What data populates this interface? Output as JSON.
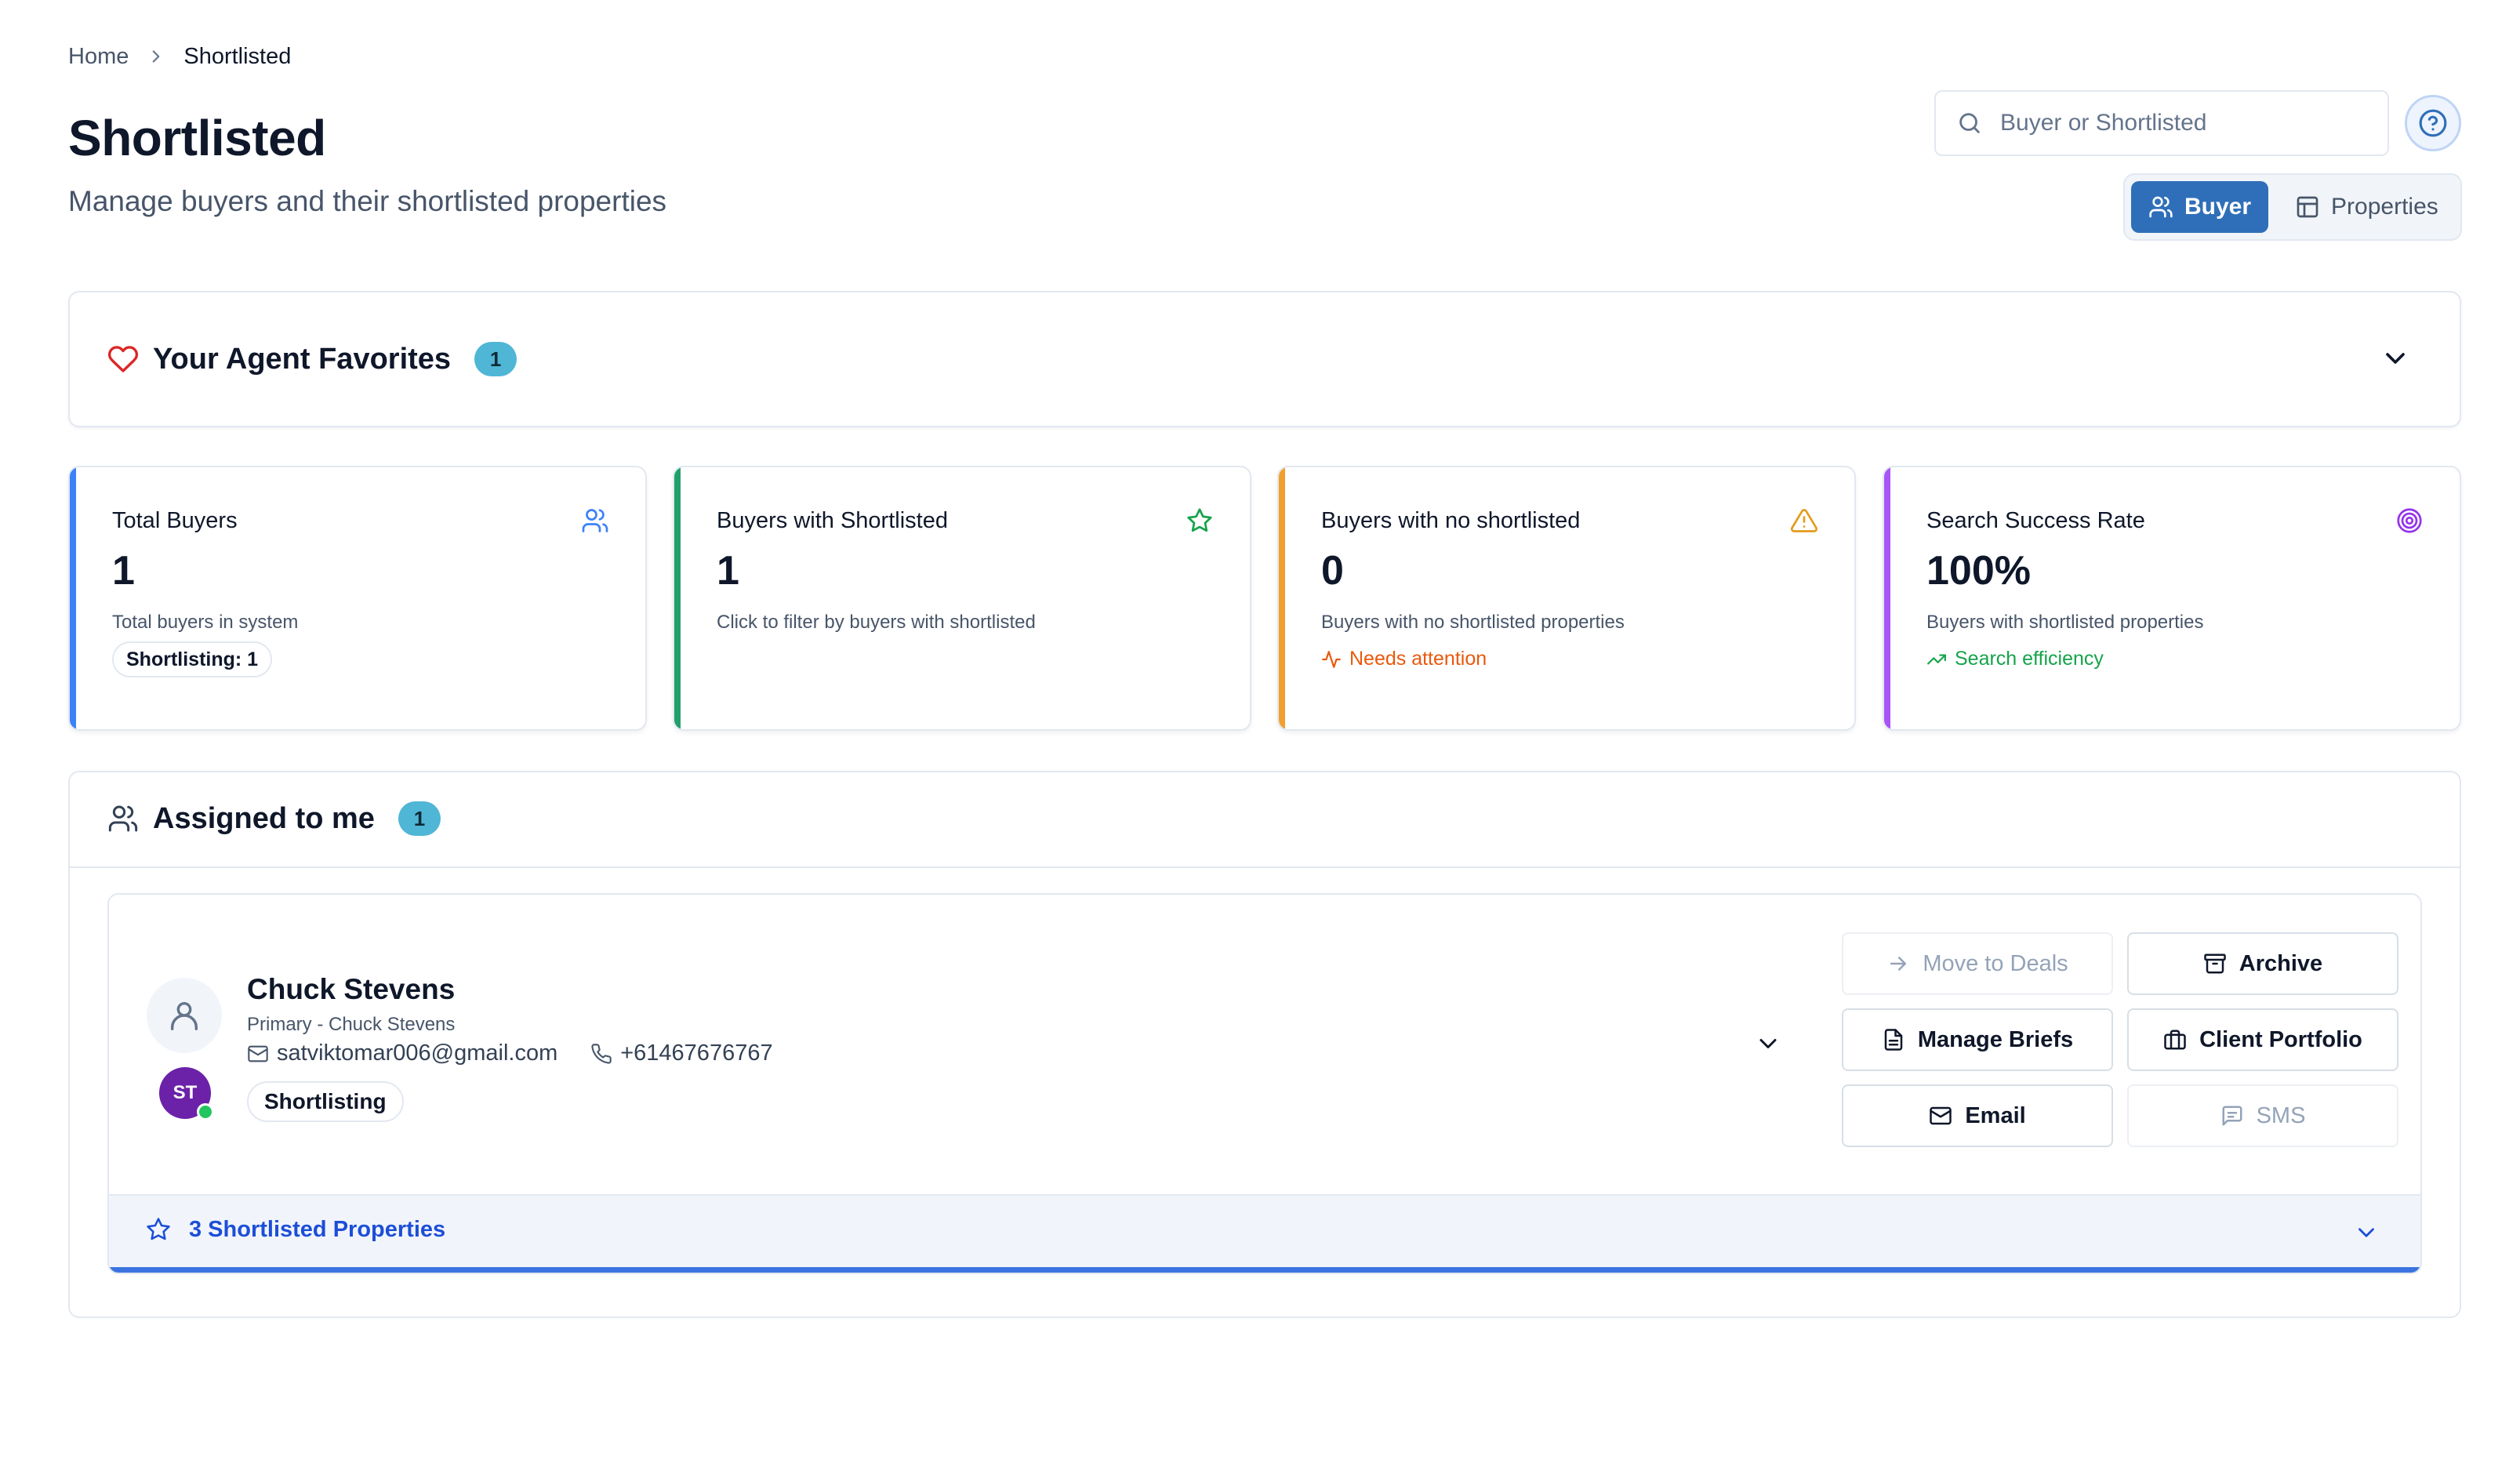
{
  "breadcrumb": {
    "home": "Home",
    "current": "Shortlisted"
  },
  "header": {
    "title": "Shortlisted",
    "subtitle": "Manage buyers and their shortlisted properties"
  },
  "search": {
    "placeholder": "Buyer or Shortlisted",
    "value": ""
  },
  "view_toggle": {
    "buyer": "Buyer",
    "properties": "Properties",
    "selected": "Buyer"
  },
  "favorites": {
    "title": "Your Agent Favorites",
    "count": "1"
  },
  "stats": [
    {
      "label": "Total Buyers",
      "value": "1",
      "description": "Total buyers in system",
      "pill": "Shortlisting: 1",
      "accent": "#3b82f6",
      "icon": "users-icon"
    },
    {
      "label": "Buyers with Shortlisted",
      "value": "1",
      "description": "Click to filter by buyers with shortlisted",
      "accent": "#22a06b",
      "icon": "star-icon"
    },
    {
      "label": "Buyers with no shortlisted",
      "value": "0",
      "description": "Buyers with no shortlisted properties",
      "note": "Needs attention",
      "note_color": "#ea580c",
      "accent": "#f0a030",
      "icon": "warning-icon"
    },
    {
      "label": "Search Success Rate",
      "value": "100%",
      "description": "Buyers with shortlisted properties",
      "note": "Search efficiency",
      "note_color": "#16a34a",
      "accent": "#a855f7",
      "icon": "target-icon"
    }
  ],
  "assigned": {
    "title": "Assigned to me",
    "count": "1",
    "buyer": {
      "name": "Chuck Stevens",
      "subtitle": "Primary - Chuck Stevens",
      "email": "satviktomar006@gmail.com",
      "phone": "+61467676767",
      "stage": "Shortlisting",
      "agent_initials": "ST",
      "actions": {
        "move_to_deals": "Move to Deals",
        "archive": "Archive",
        "manage_briefs": "Manage Briefs",
        "client_portfolio": "Client Portfolio",
        "email": "Email",
        "sms": "SMS"
      },
      "shortlisted": "3 Shortlisted Properties"
    }
  }
}
